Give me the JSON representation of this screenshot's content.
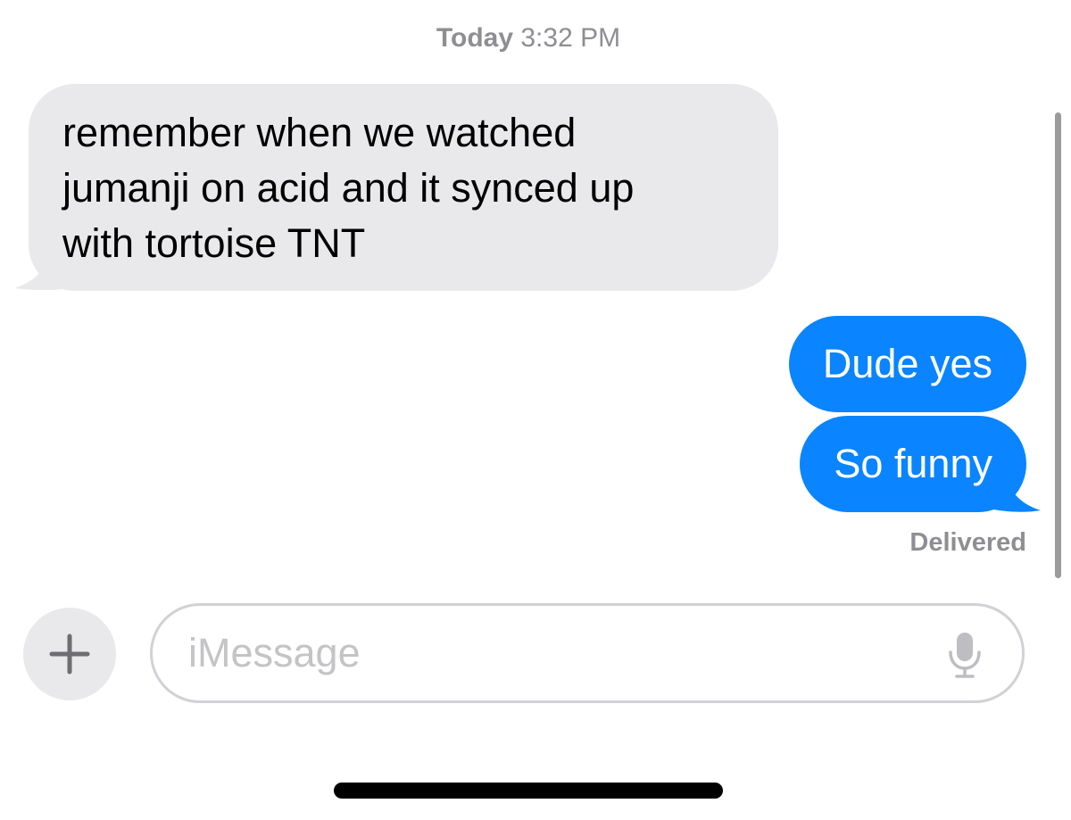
{
  "header": {
    "day": "Today",
    "time": "3:32 PM"
  },
  "messages": [
    {
      "direction": "incoming",
      "lines": [
        "remember when we watched",
        "jumanji on acid and it synced up",
        "with tortoise TNT"
      ]
    },
    {
      "direction": "outgoing",
      "text": "Dude yes"
    },
    {
      "direction": "outgoing",
      "text": "So funny"
    }
  ],
  "status": "Delivered",
  "composer": {
    "placeholder": "iMessage",
    "add_icon": "plus-icon",
    "mic_icon": "microphone-icon"
  },
  "colors": {
    "incoming_bubble": "#e9e9eb",
    "outgoing_bubble": "#0a84ff",
    "secondary_text": "#8e8e93"
  }
}
